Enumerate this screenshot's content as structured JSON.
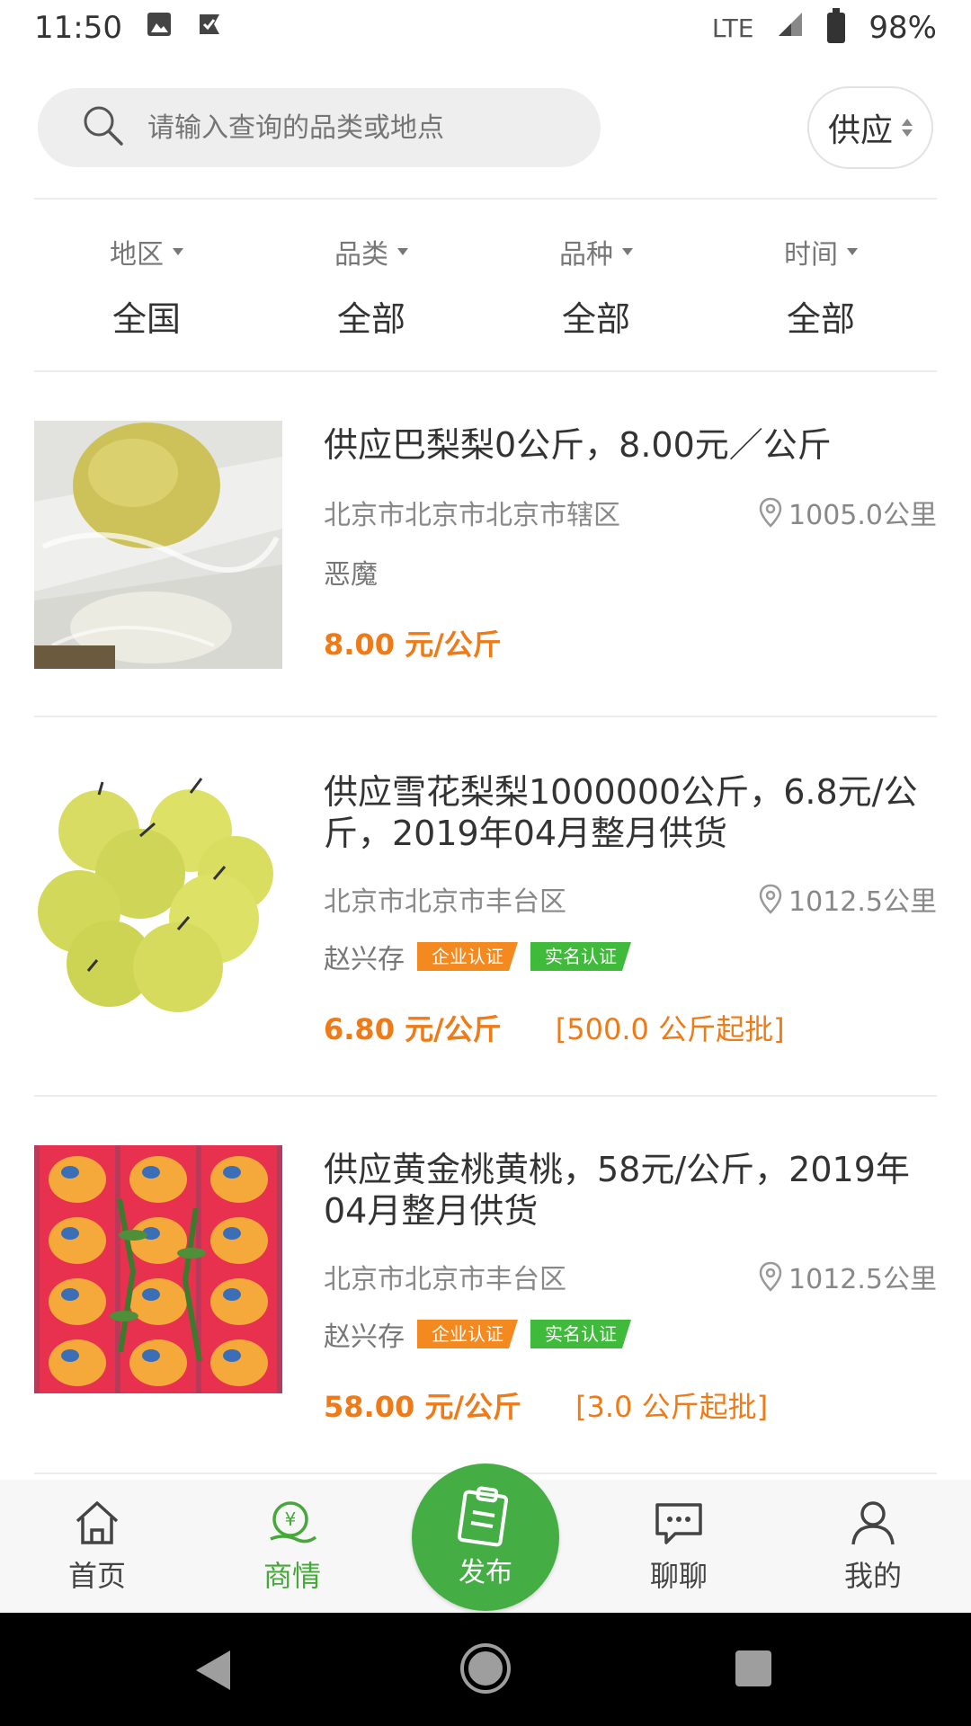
{
  "status_bar": {
    "time": "11:50",
    "network": "LTE",
    "battery": "98%"
  },
  "search": {
    "placeholder": "请输入查询的品类或地点",
    "type_select": "供应"
  },
  "filters": [
    {
      "label": "地区",
      "value": "全国"
    },
    {
      "label": "品类",
      "value": "全部"
    },
    {
      "label": "品种",
      "value": "全部"
    },
    {
      "label": "时间",
      "value": "全部"
    }
  ],
  "listings": [
    {
      "title": "供应巴梨梨0公斤，8.00元／公斤",
      "location": "北京市北京市北京市辖区",
      "distance": "1005.0公里",
      "seller": "恶魔",
      "price": "8.00 元/公斤",
      "min_batch": ""
    },
    {
      "title": "供应雪花梨梨1000000公斤，6.8元/公斤，2019年04月整月供货",
      "location": "北京市北京市丰台区",
      "distance": "1012.5公里",
      "seller": "赵兴存",
      "badge_company": "企业认证",
      "badge_realname": "实名认证",
      "price": "6.80 元/公斤",
      "min_batch": "[500.0 公斤起批]"
    },
    {
      "title": "供应黄金桃黄桃，58元/公斤，2019年04月整月供货",
      "location": "北京市北京市丰台区",
      "distance": "1012.5公里",
      "seller": "赵兴存",
      "badge_company": "企业认证",
      "badge_realname": "实名认证",
      "price": "58.00 元/公斤",
      "min_batch": "[3.0 公斤起批]"
    }
  ],
  "bottom_nav": {
    "home": "首页",
    "market": "商情",
    "publish": "发布",
    "chat": "聊聊",
    "mine": "我的"
  },
  "colors": {
    "accent_green": "#46a83a",
    "price_orange": "#ef7a16",
    "badge_orange": "#f4891f",
    "badge_green": "#3fba3a"
  }
}
